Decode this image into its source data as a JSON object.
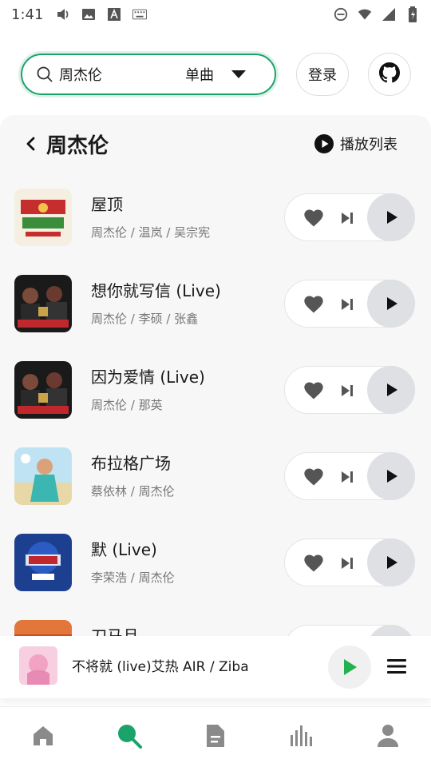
{
  "status": {
    "time": "1:41"
  },
  "search": {
    "query": "周杰伦",
    "type": "单曲"
  },
  "header": {
    "login_label": "登录"
  },
  "panel": {
    "title": "周杰伦",
    "playlist_label": "播放列表"
  },
  "songs": [
    {
      "title": "屋顶",
      "artists": "周杰伦 / 温岚 / 吴宗宪"
    },
    {
      "title": "想你就写信 (Live)",
      "artists": "周杰伦 / 李硕 / 张鑫"
    },
    {
      "title": "因为爱情 (Live)",
      "artists": "周杰伦 / 那英"
    },
    {
      "title": "布拉格广场",
      "artists": "蔡依林 / 周杰伦"
    },
    {
      "title": "默 (Live)",
      "artists": "李荣浩 / 周杰伦"
    },
    {
      "title": "刀马旦",
      "artists": ""
    }
  ],
  "player": {
    "now_playing": "不将就 (live)艾热 AIR / Ziba"
  },
  "colors": {
    "accent": "#1aa36b",
    "play_green": "#22b14c"
  },
  "nav": [
    "home-icon",
    "search-icon",
    "document-icon",
    "chart-icon",
    "user-icon"
  ]
}
